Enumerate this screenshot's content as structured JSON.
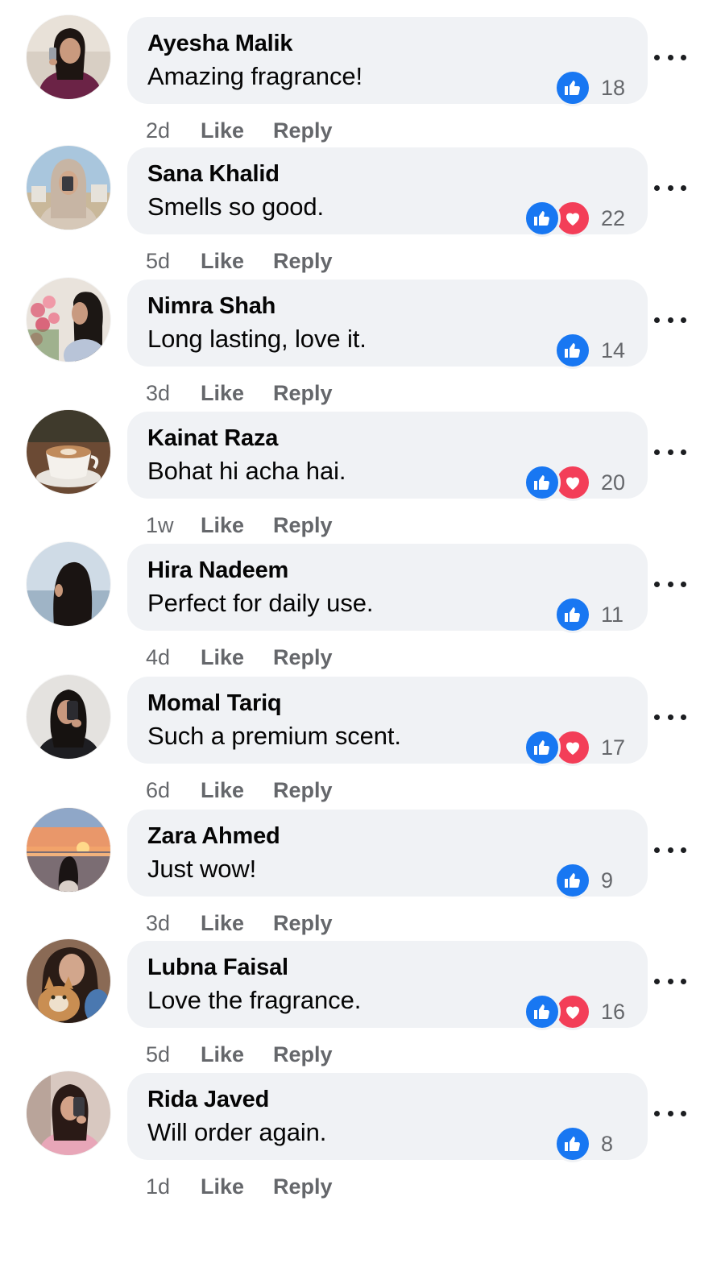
{
  "comments": [
    {
      "author": "Ayesha Malik",
      "text": "Amazing fragrance!",
      "reactions": [
        "like"
      ],
      "count": "18",
      "time": "2d",
      "like": "Like",
      "reply": "Reply"
    },
    {
      "author": "Sana Khalid",
      "text": "Smells so good.",
      "reactions": [
        "like",
        "love"
      ],
      "count": "22",
      "time": "5d",
      "like": "Like",
      "reply": "Reply"
    },
    {
      "author": "Nimra Shah",
      "text": "Long lasting, love it.",
      "reactions": [
        "like"
      ],
      "count": "14",
      "time": "3d",
      "like": "Like",
      "reply": "Reply"
    },
    {
      "author": "Kainat Raza",
      "text": "Bohat hi acha hai.",
      "reactions": [
        "like",
        "love"
      ],
      "count": "20",
      "time": "1w",
      "like": "Like",
      "reply": "Reply"
    },
    {
      "author": "Hira Nadeem",
      "text": "Perfect for daily use.",
      "reactions": [
        "like"
      ],
      "count": "11",
      "time": "4d",
      "like": "Like",
      "reply": "Reply"
    },
    {
      "author": "Momal Tariq",
      "text": "Such a premium scent.",
      "reactions": [
        "like",
        "love"
      ],
      "count": "17",
      "time": "6d",
      "like": "Like",
      "reply": "Reply"
    },
    {
      "author": "Zara Ahmed",
      "text": "Just wow!",
      "reactions": [
        "like"
      ],
      "count": "9",
      "time": "3d",
      "like": "Like",
      "reply": "Reply"
    },
    {
      "author": "Lubna Faisal",
      "text": "Love the fragrance.",
      "reactions": [
        "like",
        "love"
      ],
      "count": "16",
      "time": "5d",
      "like": "Like",
      "reply": "Reply"
    },
    {
      "author": "Rida Javed",
      "text": "Will order again.",
      "reactions": [
        "like"
      ],
      "count": "8",
      "time": "1d",
      "like": "Like",
      "reply": "Reply"
    }
  ],
  "colors": {
    "bubble": "#f0f2f5",
    "like_blue": "#1877f2",
    "love_red": "#f33e58",
    "meta_gray": "#65676b"
  },
  "icons": {
    "like": "thumbs-up-icon",
    "love": "heart-icon",
    "more": "more-options-icon"
  }
}
